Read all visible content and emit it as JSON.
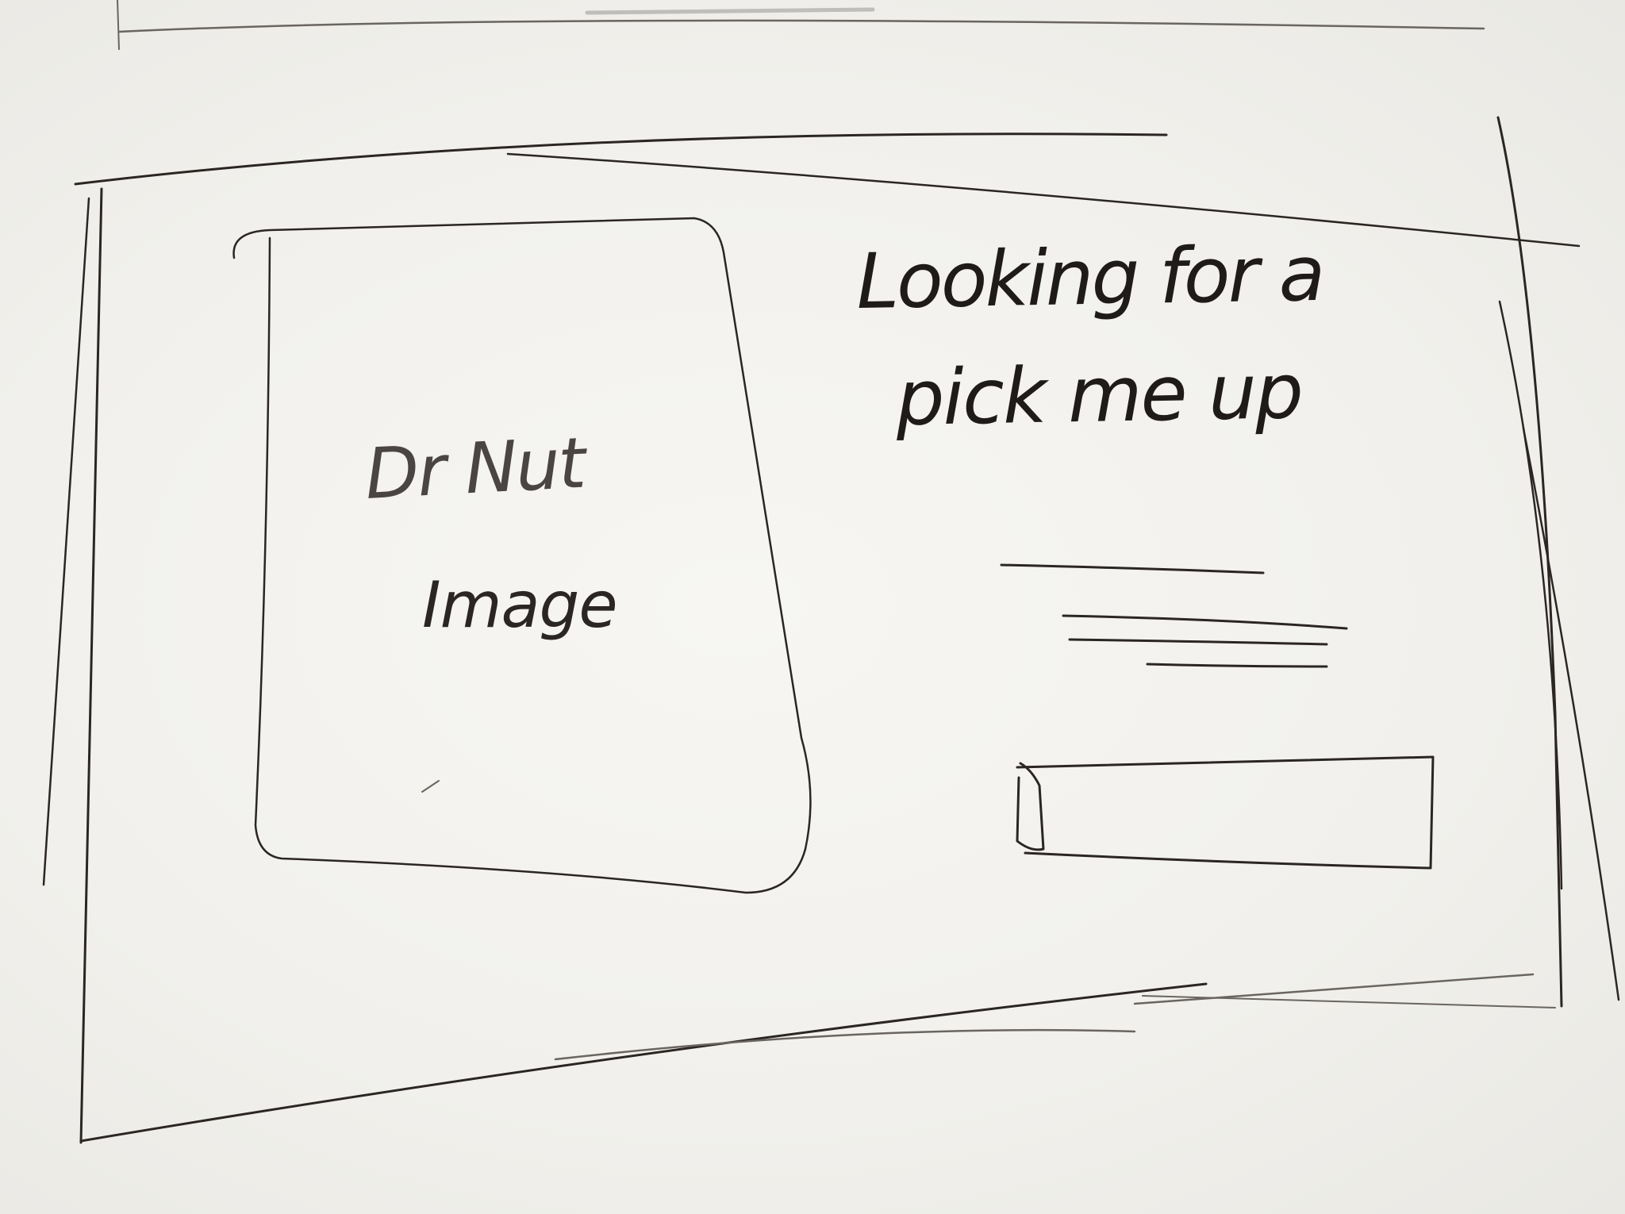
{
  "image_placeholder": {
    "line1": "Dr Nut",
    "line2": "Image"
  },
  "headline": {
    "line1": "Looking for a",
    "line2": "pick me up"
  },
  "colors": {
    "paper": "#f2f1ed",
    "ink": "#2b2623",
    "pencil": "#6a6560"
  }
}
